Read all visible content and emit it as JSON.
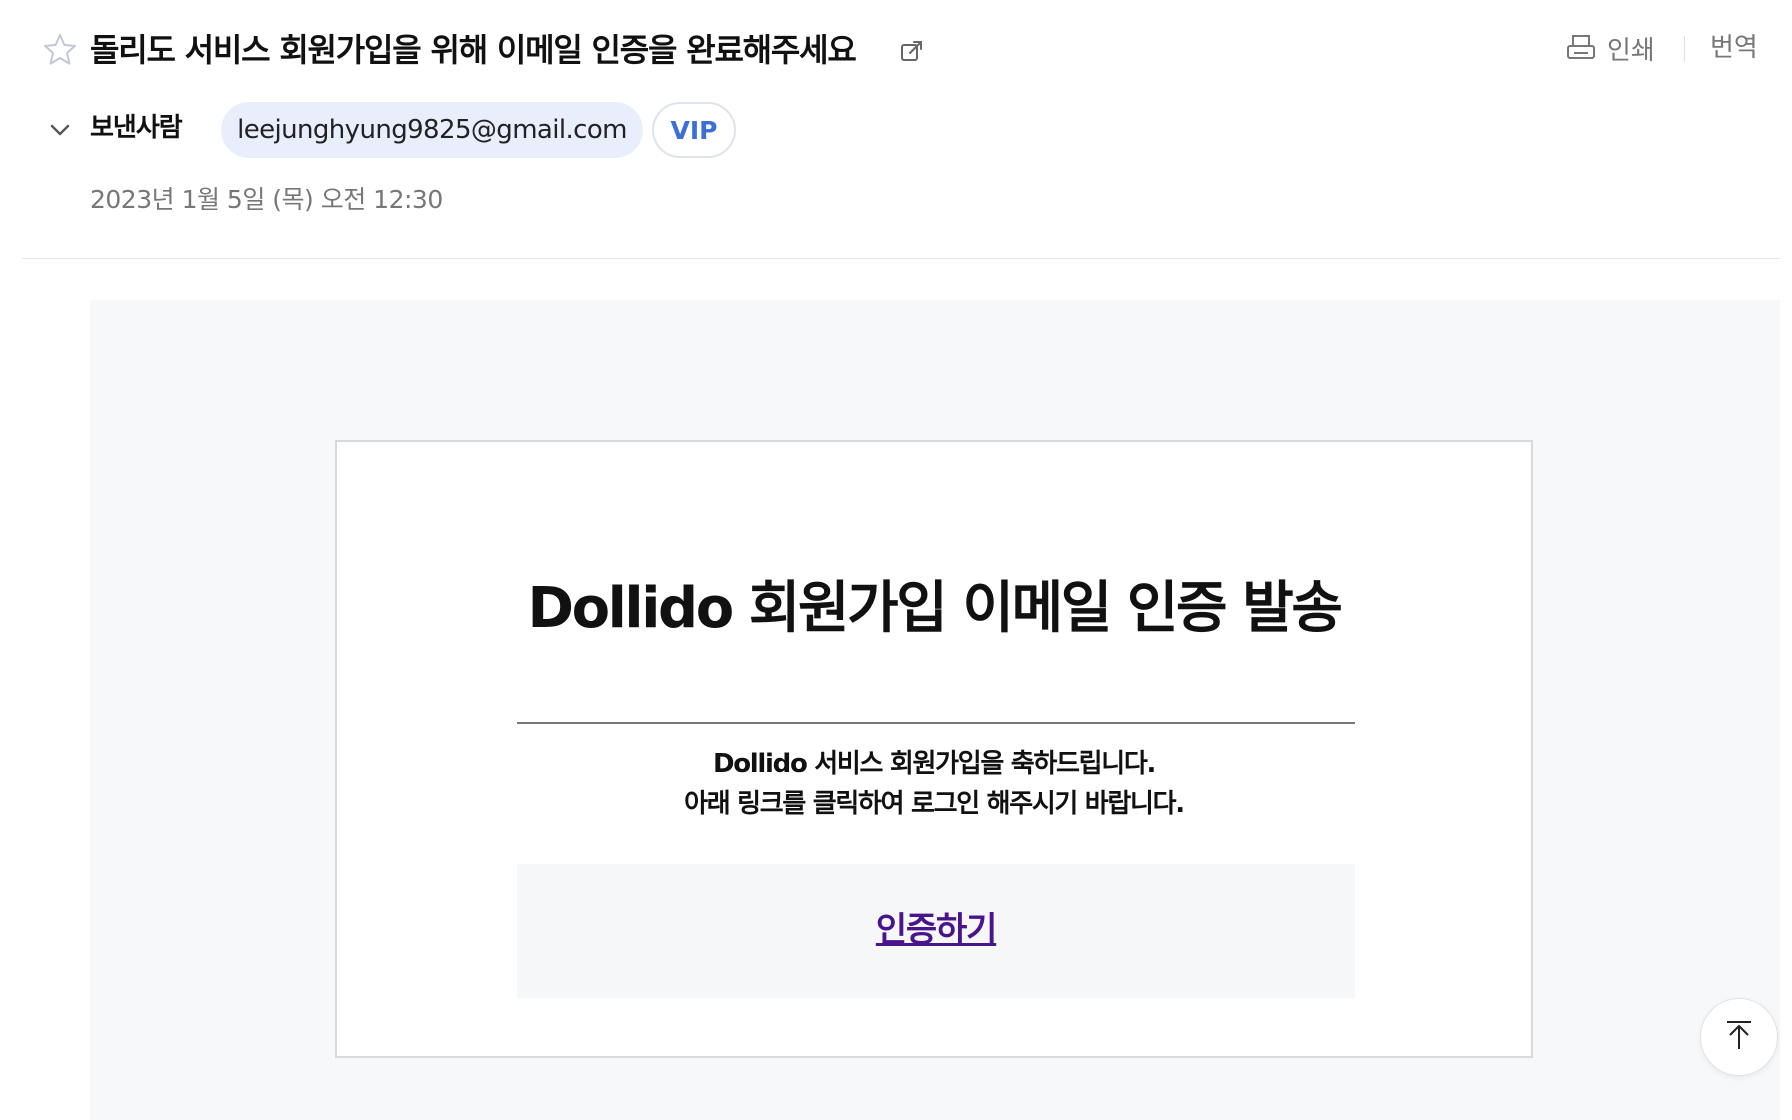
{
  "header": {
    "subject": "돌리도 서비스 회원가입을 위해 이메일 인증을 완료해주세요",
    "print_label": "인쇄",
    "translate_label": "번역",
    "star_icon": "star-icon",
    "popout_icon": "open-in-new-window-icon",
    "print_icon": "printer-icon"
  },
  "sender": {
    "label": "보낸사람",
    "email": "leejunghyung9825@gmail.com",
    "vip_label": "VIP",
    "date": "2023년 1월 5일 (목) 오전 12:30",
    "expand_icon": "chevron-down-icon"
  },
  "message": {
    "title": "Dollido 회원가입 이메일 인증 발송",
    "line1": "Dollido 서비스 회원가입을 축하드립니다.",
    "line2": "아래 링크를 클릭하여 로그인 해주시기 바랍니다.",
    "verify_link": "인증하기"
  },
  "controls": {
    "scroll_top_icon": "arrow-to-top-icon"
  },
  "colors": {
    "accent_blue": "#3a6fd8",
    "chip_bg": "#e8eefc",
    "link_purple": "#4a148c",
    "body_bg": "#f7f8fa"
  }
}
